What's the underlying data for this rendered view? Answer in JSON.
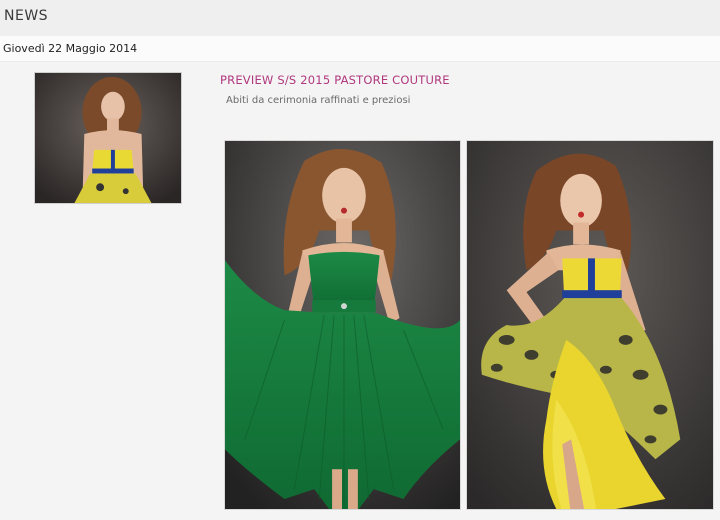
{
  "header": {
    "title": "NEWS"
  },
  "date": "Giovedì 22 Maggio 2014",
  "article": {
    "title": "PREVIEW S/S 2015 PASTORE COUTURE",
    "subtitle": "Abiti da cerimonia raffinati e preziosi"
  },
  "colors": {
    "accent_title": "#b0387e",
    "dress_green": "#1f8a45",
    "dress_yellow": "#e8d935",
    "dress_blue": "#1f3f9a"
  }
}
